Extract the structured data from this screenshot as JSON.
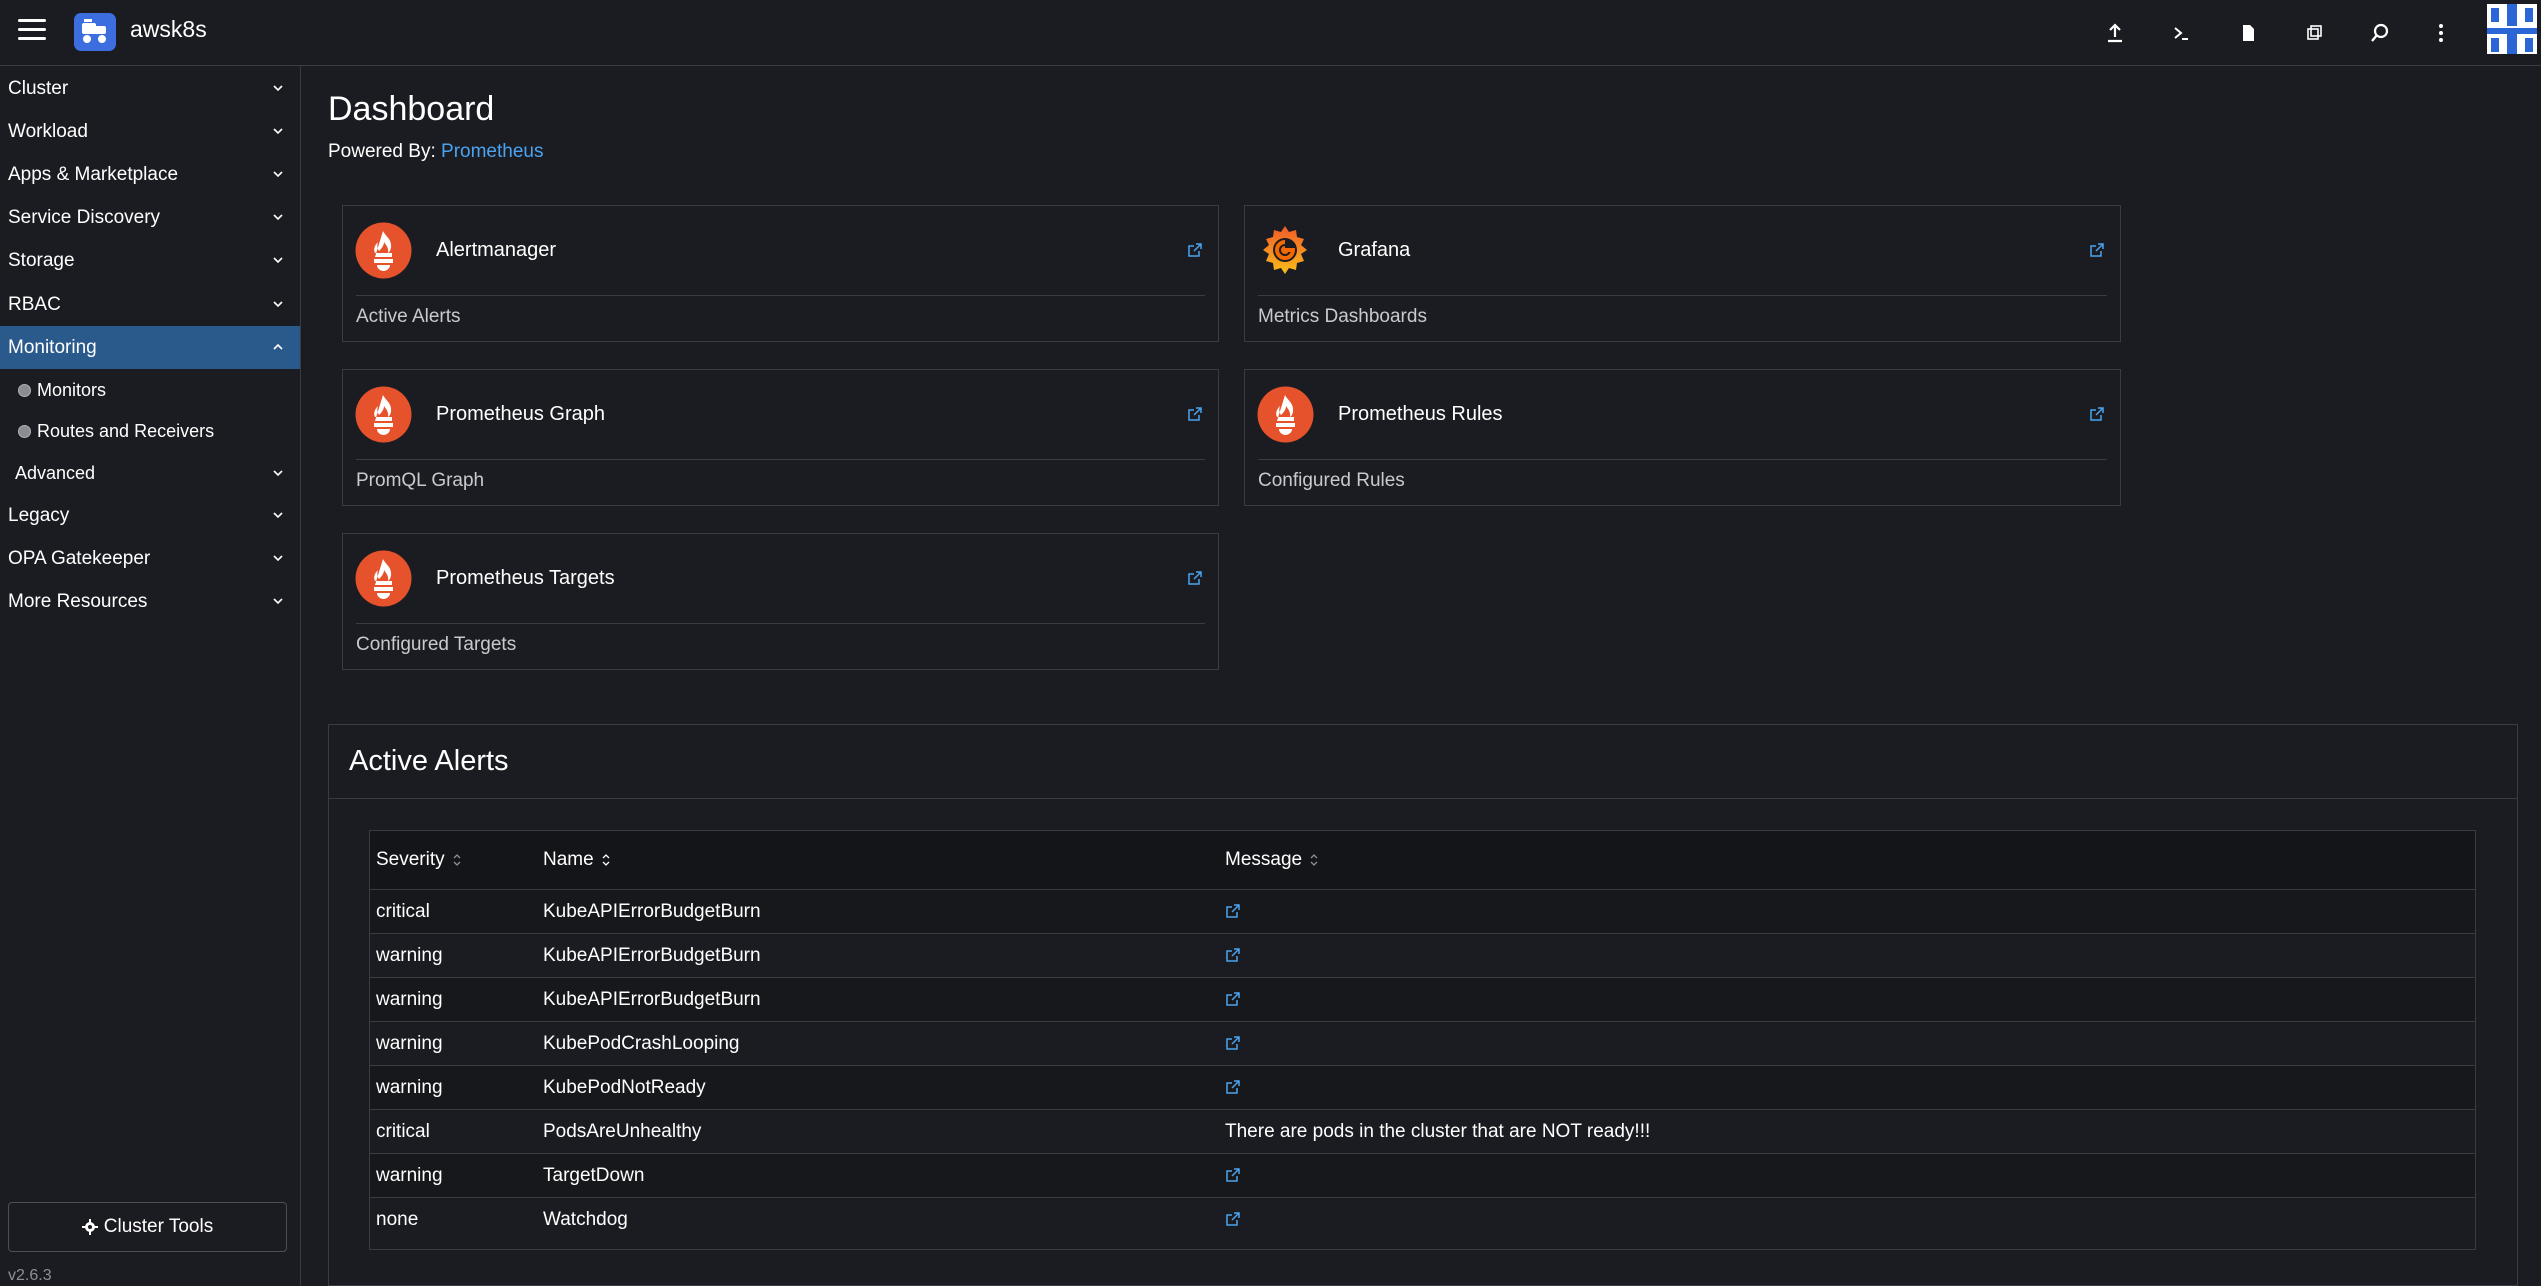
{
  "header": {
    "cluster_name": "awsk8s",
    "icons": [
      "menu-icon",
      "cluster-logo-icon",
      "upload-icon",
      "shell-icon",
      "file-icon",
      "copy-icon",
      "search-icon",
      "more-vertical-icon"
    ]
  },
  "sidebar": {
    "groups": [
      {
        "label": "Cluster"
      },
      {
        "label": "Workload"
      },
      {
        "label": "Apps & Marketplace"
      },
      {
        "label": "Service Discovery"
      },
      {
        "label": "Storage"
      },
      {
        "label": "RBAC"
      },
      {
        "label": "Monitoring"
      },
      {
        "label": "Legacy"
      },
      {
        "label": "OPA Gatekeeper"
      },
      {
        "label": "More Resources"
      }
    ],
    "monitoring_items": [
      {
        "label": "Monitors"
      },
      {
        "label": "Routes and Receivers"
      }
    ],
    "advanced_label": "Advanced",
    "cluster_tools_label": "Cluster Tools",
    "version": "v2.6.3",
    "active_color": "#2a5a8c"
  },
  "main": {
    "title": "Dashboard",
    "powered_by_label": "Powered By:",
    "powered_by_link": "Prometheus",
    "cards": [
      {
        "title": "Alertmanager",
        "subtitle": "Active Alerts",
        "icon": "prometheus-icon"
      },
      {
        "title": "Grafana",
        "subtitle": "Metrics Dashboards",
        "icon": "grafana-icon"
      },
      {
        "title": "Prometheus Graph",
        "subtitle": "PromQL Graph",
        "icon": "prometheus-icon"
      },
      {
        "title": "Prometheus Rules",
        "subtitle": "Configured Rules",
        "icon": "prometheus-icon"
      },
      {
        "title": "Prometheus Targets",
        "subtitle": "Configured Targets",
        "icon": "prometheus-icon"
      }
    ],
    "alerts": {
      "title": "Active Alerts",
      "columns": [
        "Severity",
        "Name",
        "Message"
      ],
      "rows": [
        {
          "severity": "critical",
          "name": "KubeAPIErrorBudgetBurn",
          "message": ""
        },
        {
          "severity": "warning",
          "name": "KubeAPIErrorBudgetBurn",
          "message": ""
        },
        {
          "severity": "warning",
          "name": "KubeAPIErrorBudgetBurn",
          "message": ""
        },
        {
          "severity": "warning",
          "name": "KubePodCrashLooping",
          "message": ""
        },
        {
          "severity": "warning",
          "name": "KubePodNotReady",
          "message": ""
        },
        {
          "severity": "critical",
          "name": "PodsAreUnhealthy",
          "message": "There are pods in the cluster that are NOT ready!!!"
        },
        {
          "severity": "warning",
          "name": "TargetDown",
          "message": ""
        },
        {
          "severity": "none",
          "name": "Watchdog",
          "message": ""
        }
      ]
    },
    "colors": {
      "prometheus": "#e6522c",
      "link": "#4ba3f0",
      "grafana_orange": "#f46800",
      "grafana_yellow": "#fbbd1b"
    }
  }
}
